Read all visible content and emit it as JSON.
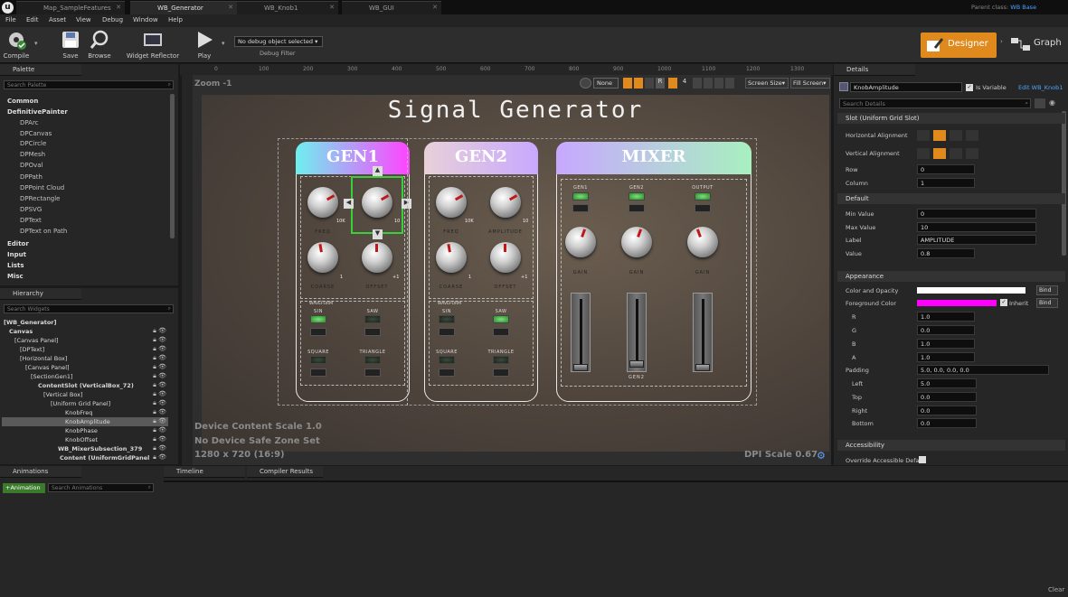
{
  "tabs": [
    {
      "label": "Map_SampleFeatures",
      "active": false
    },
    {
      "label": "WB_Generator",
      "active": true
    },
    {
      "label": "WB_Knob1",
      "active": false
    },
    {
      "label": "WB_GUI",
      "active": false
    }
  ],
  "parent_class": {
    "label": "Parent class:",
    "value": "WB Base"
  },
  "menu": [
    "File",
    "Edit",
    "Asset",
    "View",
    "Debug",
    "Window",
    "Help"
  ],
  "toolbar": {
    "compile": "Compile",
    "save": "Save",
    "browse": "Browse",
    "widget_reflector": "Widget Reflector",
    "play": "Play",
    "debug_dropdown": "No debug object selected",
    "debug_filter": "Debug Filter"
  },
  "mode": {
    "designer": "Designer",
    "graph": "Graph"
  },
  "palette": {
    "title": "Palette",
    "search_placeholder": "Search Palette",
    "items": [
      "Common",
      "DefinitivePainter",
      "DPArc",
      "DPCanvas",
      "DPCircle",
      "DPMesh",
      "DPOval",
      "DPPath",
      "DPPoint Cloud",
      "DPRectangle",
      "DPSVG",
      "DPText",
      "DPText on Path",
      "Editor",
      "Input",
      "Lists",
      "Misc"
    ]
  },
  "hierarchy": {
    "title": "Hierarchy",
    "search_placeholder": "Search Widgets",
    "items": [
      "[WB_Generator]",
      "Canvas",
      "[Canvas Panel]",
      "[DPText]",
      "[Horizontal Box]",
      "[Canvas Panel]",
      "[SectionGen1]",
      "ContentSlot (VerticalBox_72)",
      "[Vertical Box]",
      "[Uniform Grid Panel]",
      "KnobFreq",
      "KnobAmplitude",
      "KnobPhase",
      "KnobOffset",
      "WB_MixerSubsection_379",
      "Content (UniformGridPanel"
    ]
  },
  "canvas": {
    "zoom": "Zoom -1",
    "none_btn": "None",
    "r_btn": "R",
    "grid_value": "4",
    "screen_size": "Screen Size",
    "fill_screen": "Fill Screen",
    "device_scale": "Device Content Scale 1.0",
    "safe_zone": "No Device Safe Zone Set",
    "resolution": "1280 x 720 (16:9)",
    "dpi": "DPI Scale 0.67",
    "ruler": [
      "0",
      "100",
      "200",
      "300",
      "400",
      "500",
      "600",
      "700",
      "800",
      "900",
      "1000",
      "1100",
      "1200",
      "1300"
    ]
  },
  "design": {
    "title": "Signal Generator",
    "gen1": {
      "title": "GEN1",
      "knobs": [
        "FREQ",
        "",
        "COARSE",
        "OFFSET"
      ],
      "scale": [
        "10K",
        "10",
        "1",
        "+1"
      ],
      "waves": [
        "SIN",
        "SAW",
        "SQUARE",
        "TRIANGLE"
      ],
      "waves_label": "WAVEFORM"
    },
    "gen2": {
      "title": "GEN2",
      "knobs": [
        "FREQ",
        "AMPLITUDE",
        "COARSE",
        "OFFSET"
      ],
      "scale": [
        "10K",
        "10",
        "1",
        "+1"
      ],
      "waves": [
        "SIN",
        "SAW",
        "SQUARE",
        "TRIANGLE"
      ],
      "waves_label": "WAVEFORM"
    },
    "mixer": {
      "title": "MIXER",
      "channels": [
        "GEN1",
        "GEN2",
        "OUTPUT"
      ],
      "gain": "GAIN",
      "bottom": [
        "",
        "GEN2",
        ""
      ]
    }
  },
  "details": {
    "title": "Details",
    "widget_name": "KnobAmplitude",
    "is_variable": "Is Variable",
    "edit_link": "Edit WB_Knob1",
    "search_placeholder": "Search Details",
    "slot_section": "Slot (Uniform Grid Slot)",
    "horizontal_alignment": "Horizontal Alignment",
    "vertical_alignment": "Vertical Alignment",
    "row": {
      "label": "Row",
      "value": "0"
    },
    "column": {
      "label": "Column",
      "value": "1"
    },
    "default_section": "Default",
    "min_value": {
      "label": "Min Value",
      "value": "0"
    },
    "max_value": {
      "label": "Max Value",
      "value": "10"
    },
    "label": {
      "label": "Label",
      "value": "AMPLITUDE"
    },
    "value": {
      "label": "Value",
      "value": "0.8"
    },
    "appearance_section": "Appearance",
    "color_opacity": "Color and Opacity",
    "foreground_color": "Foreground Color",
    "bind": "Bind",
    "inherit": "Inherit",
    "rgba": [
      {
        "label": "R",
        "value": "1.0"
      },
      {
        "label": "G",
        "value": "0.0"
      },
      {
        "label": "B",
        "value": "1.0"
      },
      {
        "label": "A",
        "value": "1.0"
      }
    ],
    "padding": {
      "label": "Padding",
      "value": "5.0, 0.0, 0.0, 0.0"
    },
    "padding_parts": [
      {
        "label": "Left",
        "value": "5.0"
      },
      {
        "label": "Top",
        "value": "0.0"
      },
      {
        "label": "Right",
        "value": "0.0"
      },
      {
        "label": "Bottom",
        "value": "0.0"
      }
    ],
    "accessibility_section": "Accessibility",
    "override_accessible": "Override Accessible Defa"
  },
  "bottom": {
    "animations_tab": "Animations",
    "add_animation": "+Animation",
    "search_animations": "Search Animations",
    "timeline_tab": "Timeline",
    "compiler_tab": "Compiler Results",
    "clear": "Clear"
  },
  "colors": {
    "accent": "#e08a1e",
    "foreground": "#ff00ff",
    "gen1_grad": "#ff44ff",
    "gen2_grad": "#c8a8ff",
    "mixer_grad": "#a8f0c0"
  }
}
